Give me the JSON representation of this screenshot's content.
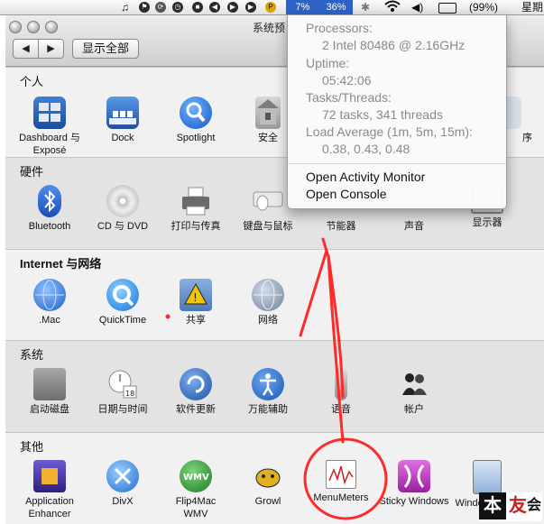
{
  "menubar": {
    "cpu_core1": "7%",
    "cpu_core2": "36%",
    "battery": "(99%)",
    "clock": "星期"
  },
  "window": {
    "title": "系统预",
    "back_label": "◀",
    "forward_label": "▶",
    "show_all": "显示全部"
  },
  "sections": {
    "personal": {
      "title": "个人",
      "items": [
        {
          "label": "Dashboard 与",
          "label2": "Exposé",
          "icon": "dashboard-icon"
        },
        {
          "label": "Dock",
          "icon": "dock-icon"
        },
        {
          "label": "Spotlight",
          "icon": "spotlight-icon"
        },
        {
          "label": "安全",
          "icon": "security-icon"
        },
        {
          "label": "序",
          "icon": "partial-icon"
        }
      ]
    },
    "hardware": {
      "title": "硬件",
      "items": [
        {
          "label": "Bluetooth",
          "icon": "bluetooth-icon"
        },
        {
          "label": "CD 与 DVD",
          "icon": "cd-dvd-icon"
        },
        {
          "label": "打印与传真",
          "icon": "printer-icon"
        },
        {
          "label": "键盘与鼠标",
          "icon": "keyboard-mouse-icon"
        },
        {
          "label": "节能器",
          "icon": "energy-saver-icon"
        },
        {
          "label": "声音",
          "icon": "sound-icon"
        },
        {
          "label": "显示器",
          "icon": "display-icon"
        }
      ]
    },
    "internet": {
      "title": "Internet 与网络",
      "items": [
        {
          "label": ".Mac",
          "icon": "mac-globe-icon"
        },
        {
          "label": "QuickTime",
          "icon": "quicktime-icon"
        },
        {
          "label": "共享",
          "icon": "sharing-icon"
        },
        {
          "label": "网络",
          "icon": "network-icon"
        }
      ]
    },
    "system": {
      "title": "系统",
      "items": [
        {
          "label": "启动磁盘",
          "icon": "startup-disk-icon"
        },
        {
          "label": "日期与时间",
          "icon": "date-time-icon"
        },
        {
          "label": "软件更新",
          "icon": "software-update-icon"
        },
        {
          "label": "万能辅助",
          "icon": "universal-access-icon"
        },
        {
          "label": "语音",
          "icon": "speech-icon"
        },
        {
          "label": "帐户",
          "icon": "accounts-icon"
        }
      ]
    },
    "other": {
      "title": "其他",
      "items": [
        {
          "label": "Application",
          "label2": "Enhancer",
          "icon": "app-enhancer-icon"
        },
        {
          "label": "DivX",
          "icon": "divx-icon"
        },
        {
          "label": "Flip4Mac",
          "label2": "WMV",
          "icon": "flip4mac-icon"
        },
        {
          "label": "Growl",
          "icon": "growl-icon"
        },
        {
          "label": "MenuMeters",
          "icon": "menumeters-icon"
        },
        {
          "label": "Sticky Windows",
          "icon": "sticky-windows-icon"
        },
        {
          "label": "WindowShade",
          "icon": "windowshade-icon"
        }
      ]
    }
  },
  "dropdown": {
    "processors_label": "Processors:",
    "processors_value": "2 Intel 80486 @ 2.16GHz",
    "uptime_label": "Uptime:",
    "uptime_value": "05:42:06",
    "tasks_label": "Tasks/Threads:",
    "tasks_value": "72 tasks, 341 threads",
    "load_label": "Load Average (1m, 5m, 15m):",
    "load_value": "0.38, 0.43, 0.48",
    "action_monitor": "Open Activity Monitor",
    "action_console": "Open Console"
  },
  "watermark": {
    "char1": "本",
    "char2": "友",
    "char3": "会"
  },
  "colors": {
    "menu_highlight": "#2d63c9",
    "annotation_red": "#ff2a2a"
  }
}
